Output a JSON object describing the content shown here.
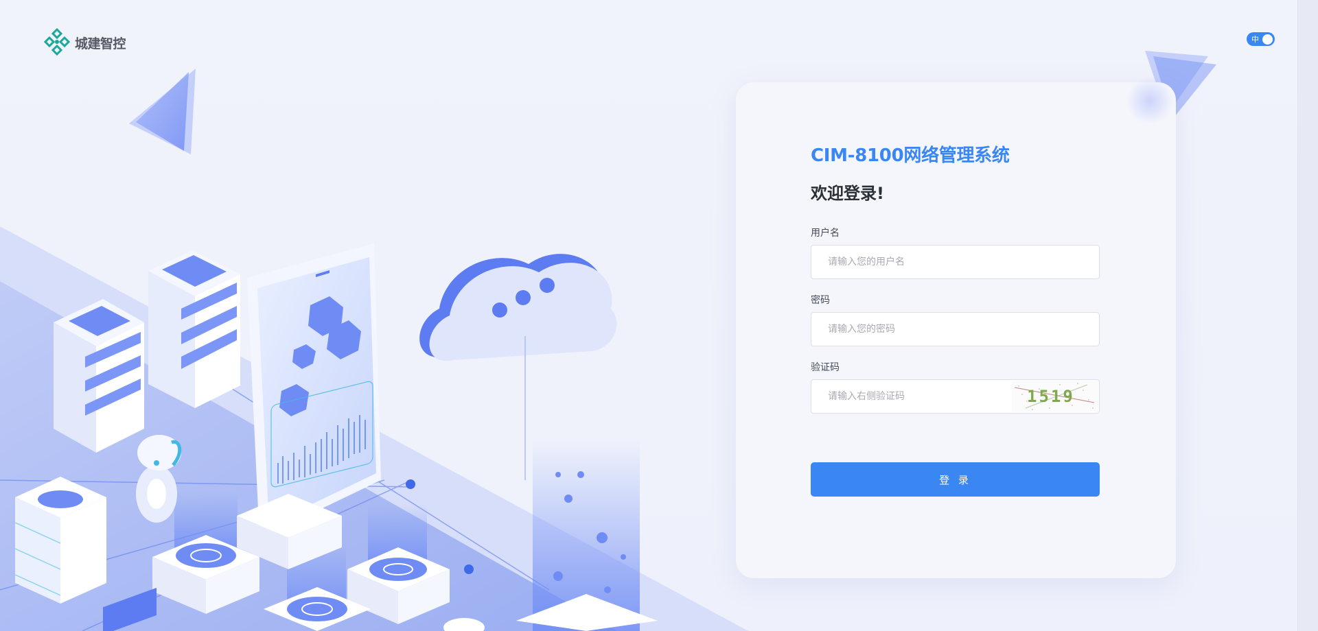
{
  "brand": {
    "name": "城建智控"
  },
  "lang_toggle": {
    "label": "中",
    "state": "on"
  },
  "login": {
    "system_title": "CIM-8100网络管理系统",
    "welcome": "欢迎登录!",
    "username": {
      "label": "用户名",
      "placeholder": "请输入您的用户名",
      "value": ""
    },
    "password": {
      "label": "密码",
      "placeholder": "请输入您的密码",
      "value": ""
    },
    "captcha": {
      "label": "验证码",
      "placeholder": "请输入右侧验证码",
      "value": "",
      "image_text": "1519"
    },
    "submit_label": "登 录"
  },
  "colors": {
    "accent": "#3a86f3",
    "illustration": "#6f8cf5",
    "background": "#eef1fb"
  }
}
